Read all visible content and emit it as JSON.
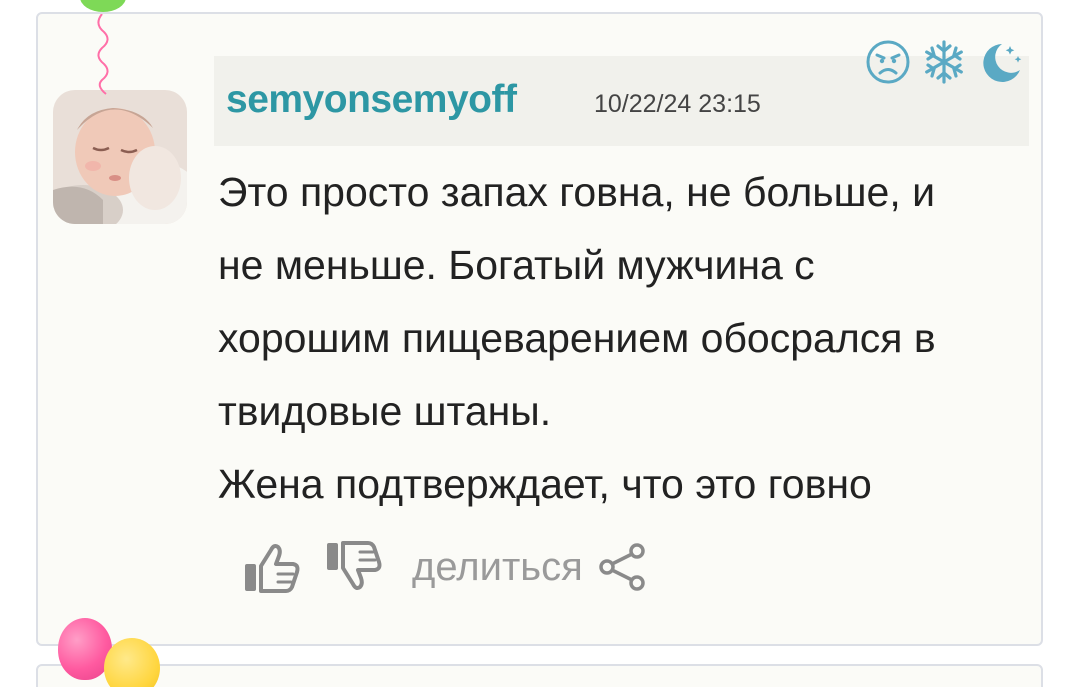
{
  "comment": {
    "username": "semyonsemyoff",
    "timestamp": "10/22/24 23:15",
    "text_lines": [
      "Это просто запах говна, не больше, и",
      "не меньше. Богатый мужчина с",
      "хорошим пищеварением обосрался в",
      "твидовые штаны.",
      "Жена подтверждает, что это говно"
    ],
    "badges": [
      "angry-face-icon",
      "snowflake-icon",
      "moon-stars-icon"
    ],
    "actions": {
      "like_icon": "thumbs-up-icon",
      "dislike_icon": "thumbs-down-icon",
      "share_label": "делиться",
      "share_icon": "share-icon"
    }
  },
  "colors": {
    "username": "#2d97a4",
    "badge": "#5aa9c4",
    "action_icon": "#8a8a8a",
    "card_bg": "#fbfbf7"
  }
}
